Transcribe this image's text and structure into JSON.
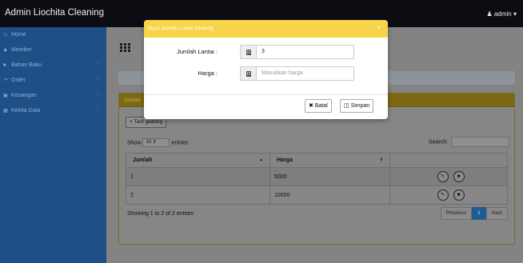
{
  "app": {
    "brand": "Admin Liochita Cleaning",
    "user": "admin"
  },
  "sidebar": {
    "items": [
      {
        "label": "Home",
        "icon": "home-icon",
        "caret": false
      },
      {
        "label": "Member",
        "icon": "users-icon",
        "caret": false
      },
      {
        "label": "Bahan Baku",
        "icon": "box-icon",
        "caret": true
      },
      {
        "label": "Order",
        "icon": "cart-icon",
        "caret": true
      },
      {
        "label": "Keuangan",
        "icon": "money-icon",
        "caret": true
      },
      {
        "label": "Kelola Data",
        "icon": "table-icon",
        "caret": true
      }
    ]
  },
  "panel": {
    "header": "Jumlah",
    "add_button": "Tarif gedung",
    "show_label": "Show",
    "entries_value": "10",
    "entries_label": "entries",
    "search_label": "Search:",
    "columns": [
      "Jumlah",
      "Harga"
    ],
    "rows": [
      {
        "jumlah": "1",
        "harga": "5000"
      },
      {
        "jumlah": "2",
        "harga": "10000"
      }
    ],
    "info": "Showing 1 to 2 of 2 entries",
    "pager": {
      "previous": "Previous",
      "current": "1",
      "next": "Next"
    }
  },
  "modal": {
    "title": "Input Jumlah Lantai Gedung",
    "close": "×",
    "fields": {
      "lantai_label": "Jumlah Lantai :",
      "lantai_value": "3",
      "harga_label": "Harga :",
      "harga_placeholder": "Masukkan harga"
    },
    "buttons": {
      "cancel": "Batal",
      "save": "Simpan"
    }
  },
  "colors": {
    "modal_header": "#f7d44a",
    "sidebar": "#1e4f86",
    "topbar": "#0b0d12"
  }
}
